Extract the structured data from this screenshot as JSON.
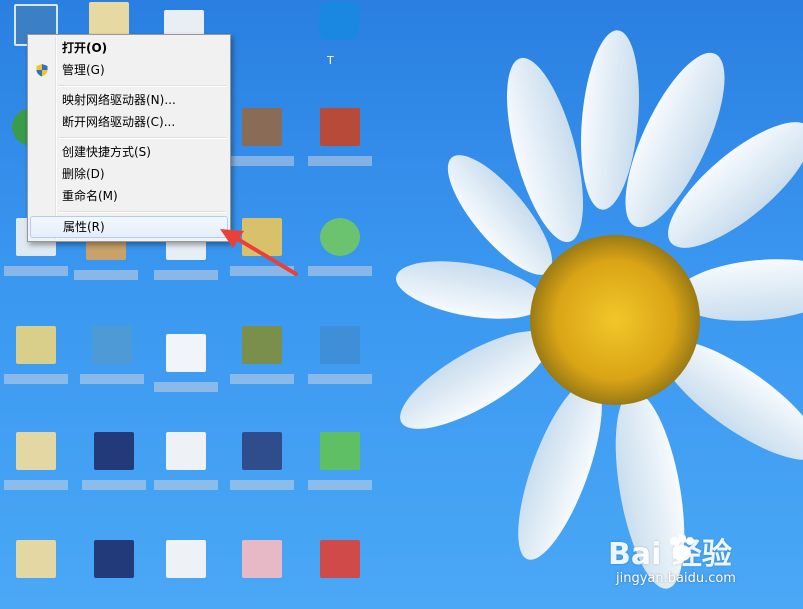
{
  "context_menu": {
    "items": [
      {
        "label": "打开(O)",
        "bold": true
      },
      {
        "label": "管理(G)",
        "icon": "uac-shield-icon"
      },
      {
        "label": "映射网络驱动器(N)..."
      },
      {
        "label": "断开网络驱动器(C)..."
      },
      {
        "label": "创建快捷方式(S)"
      },
      {
        "label": "删除(D)"
      },
      {
        "label": "重命名(M)"
      },
      {
        "label": "属性(R)",
        "highlighted": true
      }
    ]
  },
  "annotation": {
    "arrow_color": "#e8413c"
  },
  "desktop_icons": {
    "visible_label": "T"
  },
  "watermark": {
    "logo": "Bai  经验",
    "site": "jingyan.baidu.com"
  }
}
